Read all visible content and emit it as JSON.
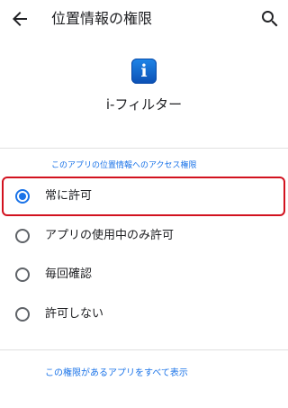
{
  "header": {
    "back_icon": "back-arrow-icon",
    "title": "位置情報の権限",
    "search_icon": "search-icon"
  },
  "app": {
    "icon": "i-filter-app-icon",
    "icon_glyph": "i",
    "name": "i-フィルター"
  },
  "location": {
    "section_header": "このアプリの位置情報へのアクセス権限",
    "options": [
      {
        "label": "常に許可",
        "selected": true
      },
      {
        "label": "アプリの使用中のみ許可",
        "selected": false
      },
      {
        "label": "毎回確認",
        "selected": false
      },
      {
        "label": "許可しない",
        "selected": false
      }
    ],
    "highlighted_option": "常に許可"
  },
  "footer": {
    "link": "この権限があるアプリをすべて表示"
  },
  "colors": {
    "accent": "#1a73e8",
    "highlight_border": "#d2121f",
    "text": "#202124",
    "divider": "#e0e0e0"
  }
}
